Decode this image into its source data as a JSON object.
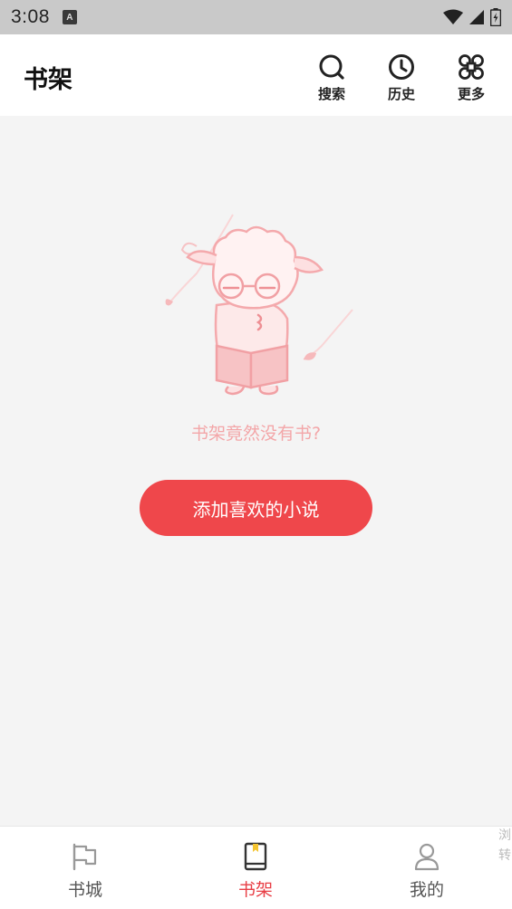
{
  "status_bar": {
    "time": "3:08",
    "notification_icon": "A"
  },
  "header": {
    "title": "书架",
    "actions": [
      {
        "label": "搜索",
        "icon": "search-icon"
      },
      {
        "label": "历史",
        "icon": "history-icon"
      },
      {
        "label": "更多",
        "icon": "more-icon"
      }
    ]
  },
  "empty_state": {
    "message": "书架竟然没有书?",
    "button_label": "添加喜欢的小说"
  },
  "bottom_nav": {
    "items": [
      {
        "label": "书城",
        "icon": "bookstore-icon",
        "active": false
      },
      {
        "label": "书架",
        "icon": "bookshelf-icon",
        "active": true
      },
      {
        "label": "我的",
        "icon": "profile-icon",
        "active": false
      }
    ],
    "edge_text": "浏\n转"
  },
  "colors": {
    "accent": "#ef474b",
    "active_nav": "#e83e45",
    "empty_text": "#f3a6a8",
    "status_bar": "#c9c9c9",
    "background": "#f4f4f4"
  }
}
